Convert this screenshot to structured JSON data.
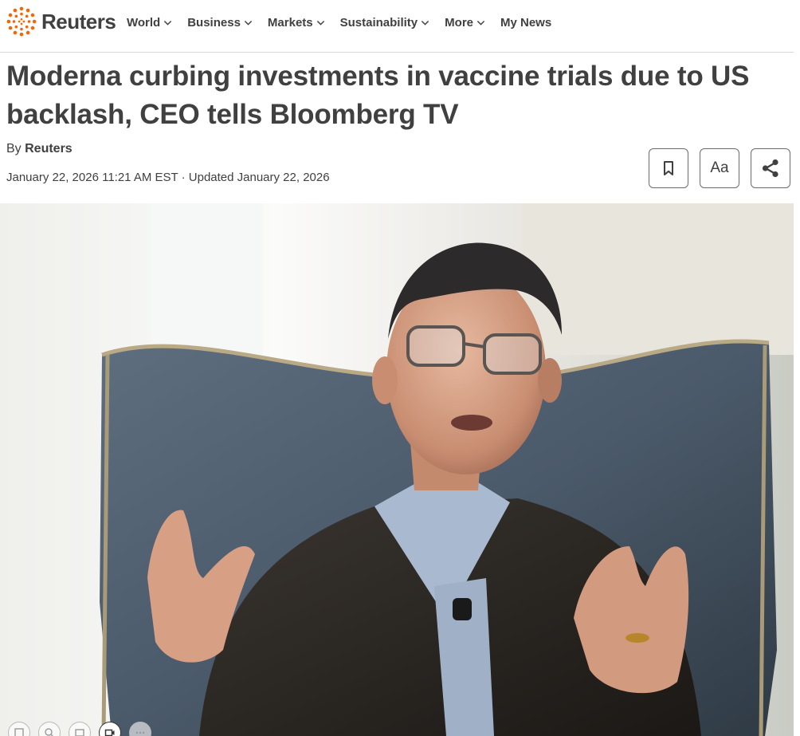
{
  "brand": {
    "name": "Reuters",
    "accent": "#fa6400"
  },
  "nav": {
    "items": [
      {
        "label": "World",
        "dropdown": true
      },
      {
        "label": "Business",
        "dropdown": true
      },
      {
        "label": "Markets",
        "dropdown": true
      },
      {
        "label": "Sustainability",
        "dropdown": true
      },
      {
        "label": "More",
        "dropdown": true
      },
      {
        "label": "My News",
        "dropdown": false
      }
    ]
  },
  "article": {
    "headline_line1": "Moderna curbing investments in vaccine trials due to US",
    "headline_line2": "backlash, CEO tells Bloomberg TV",
    "byline_prefix": "By",
    "author": "Reuters",
    "published": "January 22, 2026 11:21 AM EST",
    "separator": "·",
    "updated": "Updated January 22, 2026"
  },
  "tools": {
    "bookmark_icon": "bookmark-icon",
    "text_size_label": "Aa",
    "share_icon": "share-icon"
  },
  "photo": {
    "subject": "man in glasses seated in a blue velvet wingback chair gesturing with both hands",
    "colors": {
      "wall": "#ebeae6",
      "chair": "#4d5d6e",
      "jacket": "#2a2622",
      "shirt": "#a9b9cf"
    }
  },
  "media_controls": [
    "gallery-icon",
    "search-icon",
    "caption-icon",
    "video-icon",
    "more-icon"
  ]
}
